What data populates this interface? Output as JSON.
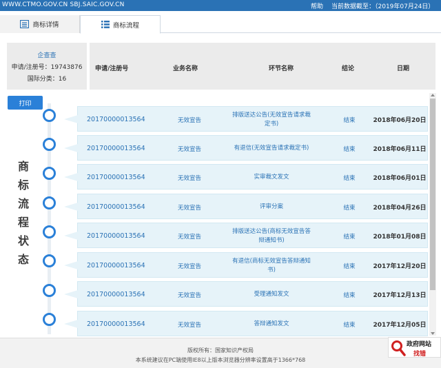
{
  "topbar": {
    "site": "WWW.CTMO.GOV.CN SBJ.SAIC.GOV.CN",
    "help": "帮助",
    "date": "当前数据截至：（2019年07月24日）"
  },
  "tabs": [
    {
      "label": "商标详情",
      "icon": "document-icon"
    },
    {
      "label": "商标流程",
      "icon": "list-icon"
    }
  ],
  "info": {
    "query": "企查查",
    "reg_number": "申请/注册号：19743876",
    "intl_class": "国际分类：16"
  },
  "columns": [
    "申请/注册号",
    "业务名称",
    "环节名称",
    "结论",
    "日期"
  ],
  "print_label": "打印",
  "vertical_title": [
    "商",
    "标",
    "流",
    "程",
    "状",
    "态"
  ],
  "rows": [
    {
      "num": "20170000013564",
      "biz": "无效宣告",
      "step": "排版送达公告(无效宣告请求裁定书)",
      "result": "结束",
      "date": "2018年06月20日"
    },
    {
      "num": "20170000013564",
      "biz": "无效宣告",
      "step": "有退信(无效宣告请求裁定书)",
      "result": "结束",
      "date": "2018年06月11日"
    },
    {
      "num": "20170000013564",
      "biz": "无效宣告",
      "step": "实审裁文发文",
      "result": "结束",
      "date": "2018年06月01日"
    },
    {
      "num": "20170000013564",
      "biz": "无效宣告",
      "step": "评审分案",
      "result": "结束",
      "date": "2018年04月26日"
    },
    {
      "num": "20170000013564",
      "biz": "无效宣告",
      "step": "排版送达公告(商标无效宣告答辩通知书)",
      "result": "结束",
      "date": "2018年01月08日"
    },
    {
      "num": "20170000013564",
      "biz": "无效宣告",
      "step": "有退信(商标无效宣告答辩通知书)",
      "result": "结束",
      "date": "2017年12月20日"
    },
    {
      "num": "20170000013564",
      "biz": "无效宣告",
      "step": "受理通知发文",
      "result": "结束",
      "date": "2017年12月13日"
    },
    {
      "num": "20170000013564",
      "biz": "无效宣告",
      "step": "答辩通知发文",
      "result": "结束",
      "date": "2017年12月05日"
    }
  ],
  "footer": {
    "copyright": "版权所有：国家知识产权局",
    "notice": "本系统建议在PC端使用IE8以上版本浏览器分辨率设置高于1366*768"
  },
  "badge": {
    "line1": "政府网站",
    "line2": "找错"
  },
  "colors": {
    "topbar": "#2a72b5",
    "accent": "#2a80d8",
    "row_bg": "#e6f3f9",
    "badge_red": "#d02020"
  }
}
